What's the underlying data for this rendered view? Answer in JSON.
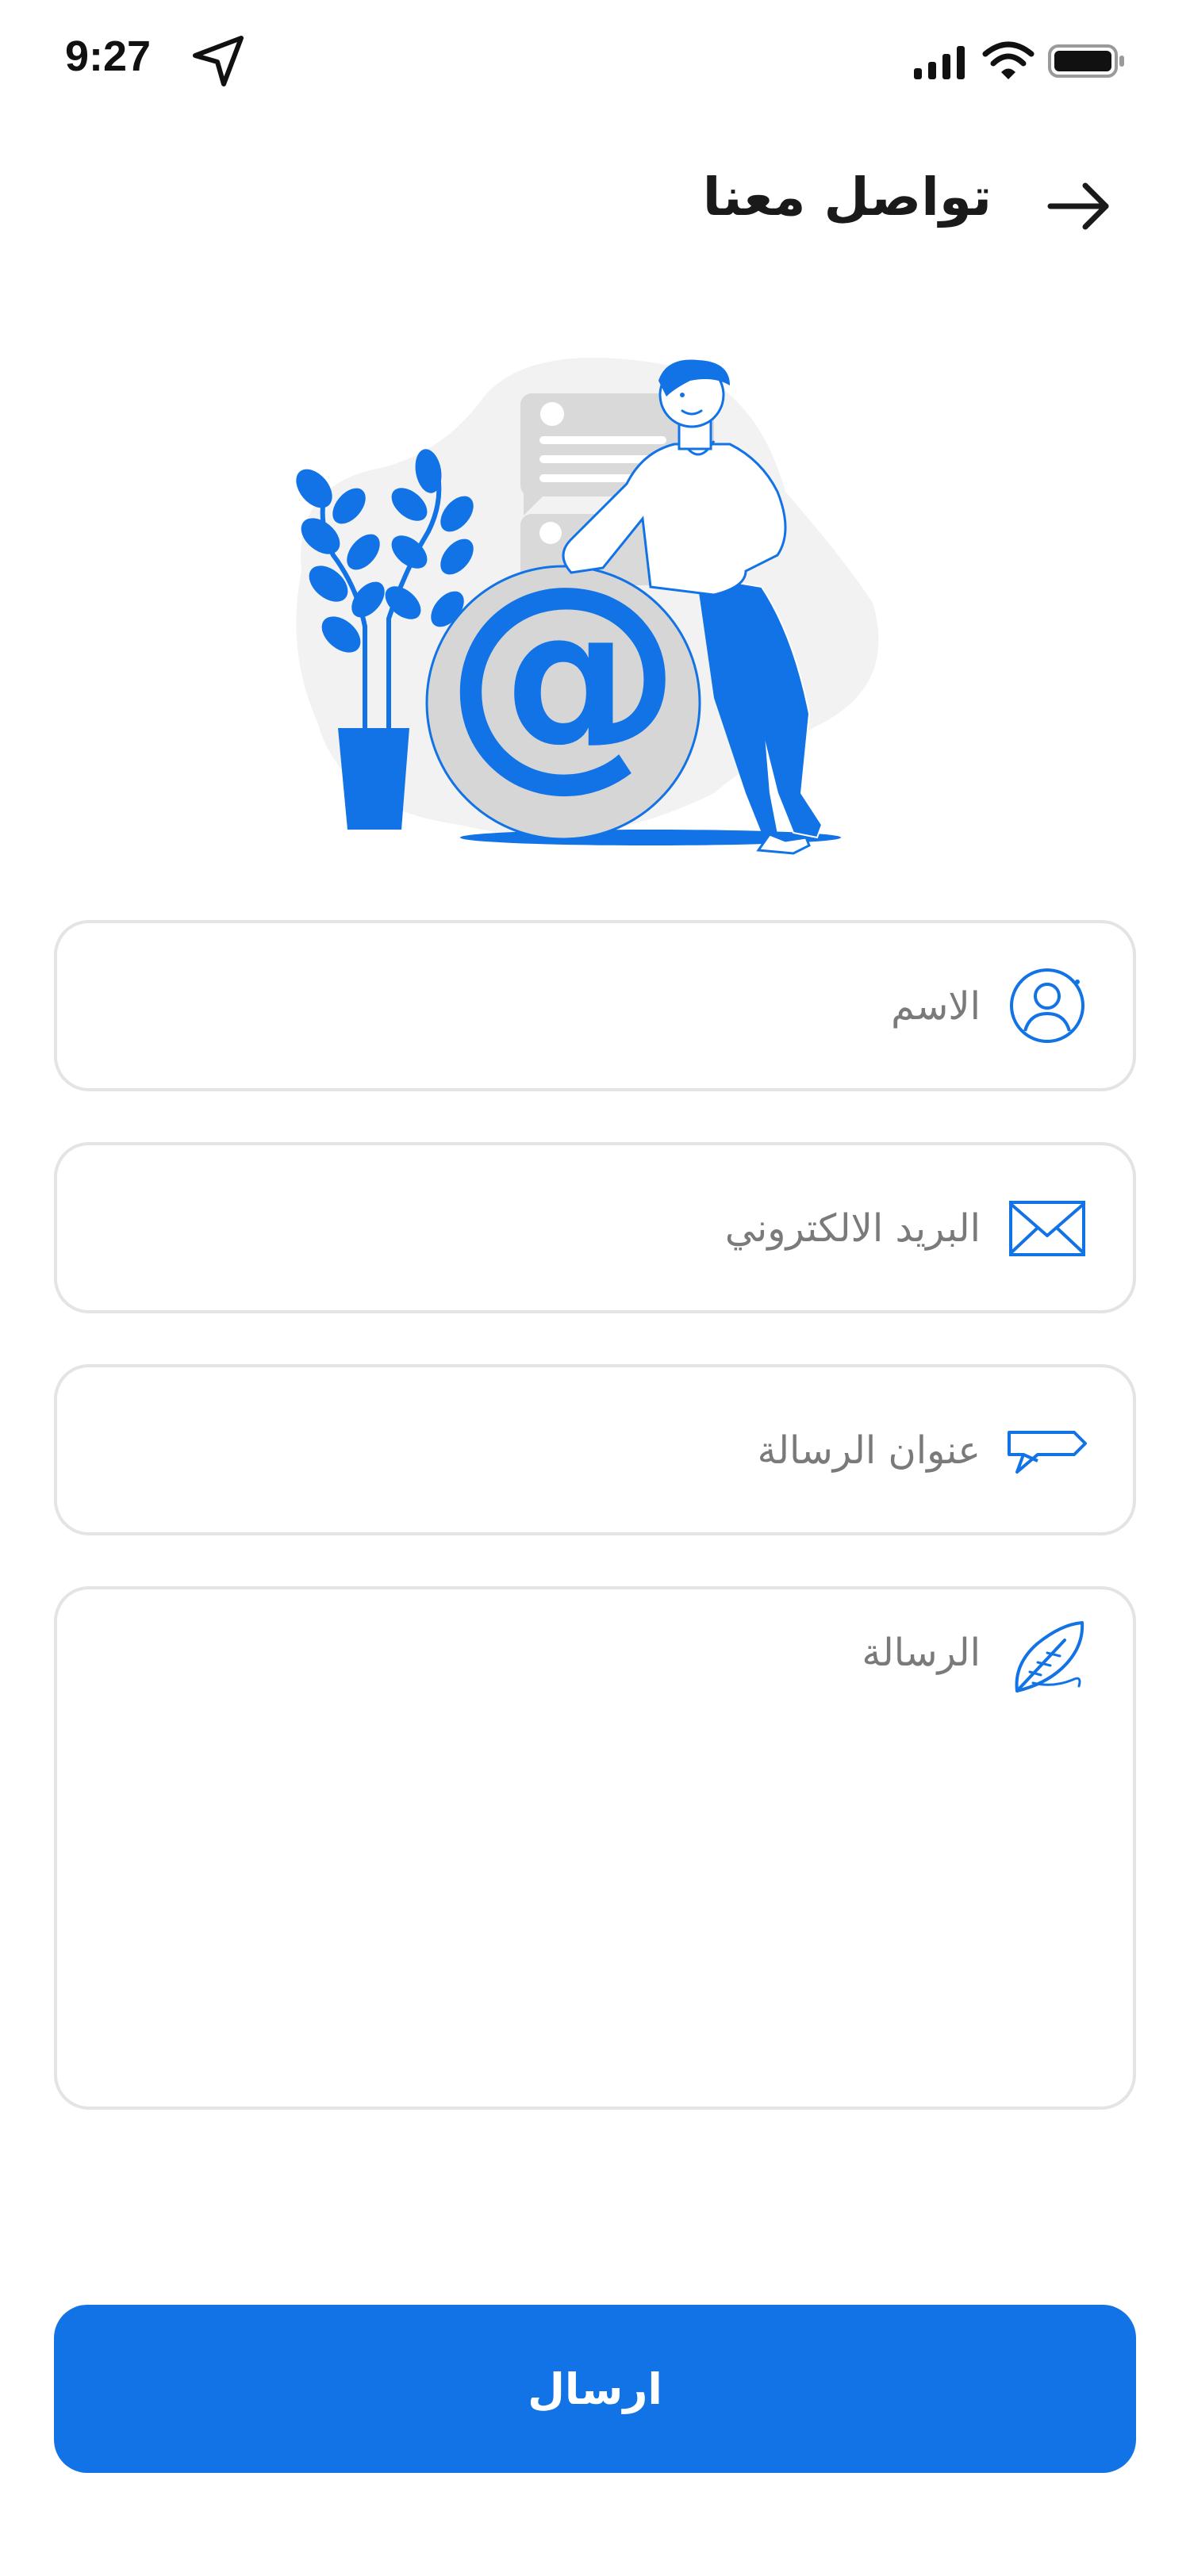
{
  "status_bar": {
    "time": "9:27",
    "icons": [
      "location-arrow-icon",
      "cellular-signal-icon",
      "wifi-icon",
      "battery-icon"
    ]
  },
  "header": {
    "title": "تواصل معنا",
    "back_icon": "arrow-right-icon"
  },
  "illustration": {
    "subject": "contact-email-illustration"
  },
  "form": {
    "name": {
      "placeholder": "الاسم",
      "value": "",
      "icon": "user-icon"
    },
    "email": {
      "placeholder": "البريد الالكتروني",
      "value": "",
      "icon": "envelope-icon"
    },
    "subject": {
      "placeholder": "عنوان الرسالة",
      "value": "",
      "icon": "message-tag-icon"
    },
    "message": {
      "placeholder": "الرسالة",
      "value": "",
      "icon": "feather-icon"
    }
  },
  "actions": {
    "send_label": "ارسال"
  },
  "colors": {
    "accent": "#1273E6",
    "field_border": "#E4E4E4",
    "placeholder": "#7A7A7A",
    "title": "#1A1A1A"
  }
}
